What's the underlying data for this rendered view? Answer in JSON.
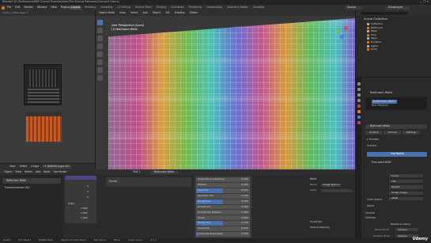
{
  "window_title": "Blender* [C:\\Professional\\WIP Current Projects\\Learn\\The Shining Bathroom\\Course\\3 Colors]",
  "menu": [
    "File",
    "Edit",
    "Render",
    "Window",
    "Help",
    "Rigging"
  ],
  "workspace_tabs": [
    "Layout",
    "Modeling",
    "Sculpting",
    "UV Editing",
    "Texture Paint",
    "Shading",
    "Animation",
    "Rendering",
    "Compositing",
    "Geometry Nodes",
    "Scripting"
  ],
  "active_tab": "Layout",
  "scene_label": "Scene",
  "view_layer_label": "ViewLayer",
  "status_top": "Scene | 2,916 tris/p.2",
  "viewport": {
    "header_items": [
      "Object Mode",
      "View",
      "Select",
      "Add",
      "Object",
      "GIS",
      "Shading",
      "Global"
    ],
    "overlay_title": "User Perspective (Local)",
    "overlay_sub": "(1) Bathroom Walls"
  },
  "outliner": {
    "title": "Scene Collection",
    "items": [
      "Collection",
      "Bathroom",
      "Walls",
      "Floor",
      "Pipes",
      "Furniture",
      "Lights",
      "Toilet"
    ]
  },
  "properties": {
    "object_name": "Bathroom Walls",
    "material_name": "Bathroom Walls",
    "sub_material": "Wall Material",
    "tabs": [
      "Surface",
      "Volume",
      "Settings"
    ],
    "surface_label": "Surface",
    "surface_value": "Use Nodes",
    "bsdf_label": "Principled BSDF",
    "rows": [
      "Linear",
      "Flat",
      "Repeat",
      "Single Image",
      "sRGB"
    ],
    "color_space_label": "Color Space",
    "alpha_label": "Alpha",
    "volume_label": "Volume",
    "settings_label": "Settings",
    "backface": "Backface Culling",
    "blend_mode_label": "Blend Mode",
    "blend_mode_value": "Opaque",
    "shadow_mode_label": "Shadow Mode",
    "shadow_mode_value": "Opaque"
  },
  "uv_editor": {
    "header": [
      "View",
      "Select",
      "Image",
      "UVs"
    ],
    "image_name": "BAKING.tsgst.001",
    "info_text": "Scene | 2,916 tris/p.2"
  },
  "node_editor": {
    "header": [
      "Object",
      "View",
      "Select",
      "Add",
      "Node",
      "Use Nodes"
    ],
    "material_field": "Bathroom Walls",
    "slot": "Slot 1",
    "sidebar_items": [
      "Frame/instance.001"
    ],
    "node_title": "Principled BSDF",
    "params": [
      {
        "name": "Subsurface Anisotropy",
        "value": "0.000"
      },
      {
        "name": "Metallic",
        "value": "0.000"
      },
      {
        "name": "Specular",
        "value": "0.500"
      },
      {
        "name": "Specular Tint",
        "value": "0.000"
      },
      {
        "name": "Roughness",
        "value": "0.500"
      },
      {
        "name": "Anisotropic",
        "value": "0.000"
      },
      {
        "name": "Anisotropic Rotation",
        "value": "0.000"
      },
      {
        "name": "Sheen",
        "value": "0.000"
      },
      {
        "name": "Sheen Tint",
        "value": "0.500"
      },
      {
        "name": "Clearcoat",
        "value": "0.000"
      },
      {
        "name": "Clearcoat Roughness",
        "value": "0.030"
      }
    ],
    "mini_node_title": "Vector",
    "vector_values": [
      "0",
      "0",
      "0"
    ],
    "scale_label": "Scale",
    "scale_values": [
      "1.000",
      "1.000",
      "1.000"
    ]
  },
  "image_node": {
    "title": "Node",
    "name_label": "Name",
    "name_value": "Image Texture",
    "label_label": "Label",
    "properties": "Properties",
    "texture_mapping": "Texture Mapping"
  },
  "status_bar": [
    "Select",
    "Box Select",
    "Rotate View",
    "Object Context Menu",
    "Set Active",
    "Move",
    "Snap Cursor",
    "3.5.1"
  ],
  "watermark": "Udemy",
  "colors": {
    "bg": "#1d1d1d",
    "panel": "#2a2a2a",
    "header": "#303030",
    "accent_blue": "#4772b3",
    "orange": "#e87d0d"
  }
}
